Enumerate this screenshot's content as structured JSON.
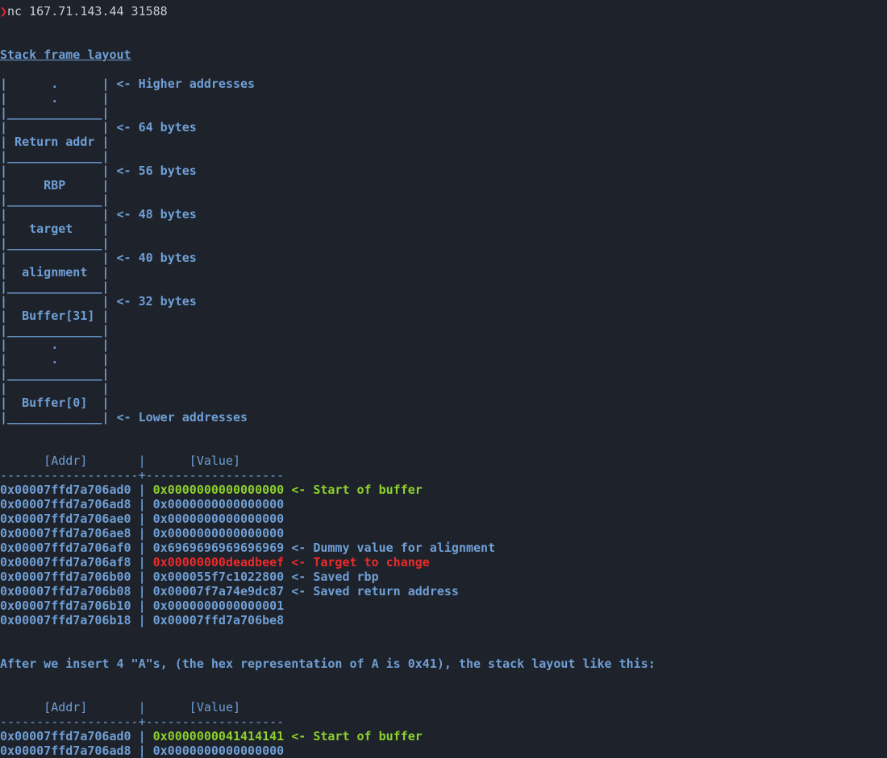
{
  "colors": {
    "background": "#1e222a",
    "text": "#6f9fd6",
    "highlight_green": "#8cd12c",
    "highlight_red": "#ea2b2b",
    "prompt": "#e8262a"
  },
  "terminal": {
    "prompt_icon": "chevron-right-icon",
    "prompt_glyph": "❯",
    "command": "nc 167.71.143.44 31588",
    "title": "Stack frame layout",
    "diagram": [
      "|      .      | <- Higher addresses",
      "|      .      |",
      "|_____________|",
      "|             | <- 64 bytes",
      "| Return addr |",
      "|_____________|",
      "|             | <- 56 bytes",
      "|     RBP     |",
      "|_____________|",
      "|             | <- 48 bytes",
      "|   target    |",
      "|_____________|",
      "|             | <- 40 bytes",
      "|  alignment  |",
      "|_____________|",
      "|             | <- 32 bytes",
      "|  Buffer[31] |",
      "|_____________|",
      "|      .      |",
      "|      .      |",
      "|_____________|",
      "|             |",
      "|  Buffer[0]  |",
      "|_____________| <- Lower addresses"
    ],
    "table1": {
      "header": "      [Addr]       |      [Value]",
      "rule": "-------------------+-------------------",
      "rows": [
        {
          "addr": "0x00007ffd7a706ad0",
          "value": "0x0000000000000000",
          "note": "<- Start of buffer",
          "style": "green"
        },
        {
          "addr": "0x00007ffd7a706ad8",
          "value": "0x0000000000000000",
          "note": "",
          "style": ""
        },
        {
          "addr": "0x00007ffd7a706ae0",
          "value": "0x0000000000000000",
          "note": "",
          "style": ""
        },
        {
          "addr": "0x00007ffd7a706ae8",
          "value": "0x0000000000000000",
          "note": "",
          "style": ""
        },
        {
          "addr": "0x00007ffd7a706af0",
          "value": "0x6969696969696969",
          "note": "<- Dummy value for alignment",
          "style": ""
        },
        {
          "addr": "0x00007ffd7a706af8",
          "value": "0x00000000deadbeef",
          "note": "<- Target to change",
          "style": "red"
        },
        {
          "addr": "0x00007ffd7a706b00",
          "value": "0x000055f7c1022800",
          "note": "<- Saved rbp",
          "style": ""
        },
        {
          "addr": "0x00007ffd7a706b08",
          "value": "0x00007f7a74e9dc87",
          "note": "<- Saved return address",
          "style": ""
        },
        {
          "addr": "0x00007ffd7a706b10",
          "value": "0x0000000000000001",
          "note": "",
          "style": ""
        },
        {
          "addr": "0x00007ffd7a706b18",
          "value": "0x00007ffd7a706be8",
          "note": "",
          "style": ""
        }
      ]
    },
    "paragraph": "After we insert 4 \"A\"s, (the hex representation of A is 0x41), the stack layout like this:",
    "table2": {
      "header": "      [Addr]       |      [Value]",
      "rule": "-------------------+-------------------",
      "rows": [
        {
          "addr": "0x00007ffd7a706ad0",
          "value": "0x0000000041414141",
          "note": "<- Start of buffer",
          "style": "green"
        },
        {
          "addr": "0x00007ffd7a706ad8",
          "value": "0x0000000000000000",
          "note": "",
          "style": ""
        }
      ]
    }
  }
}
